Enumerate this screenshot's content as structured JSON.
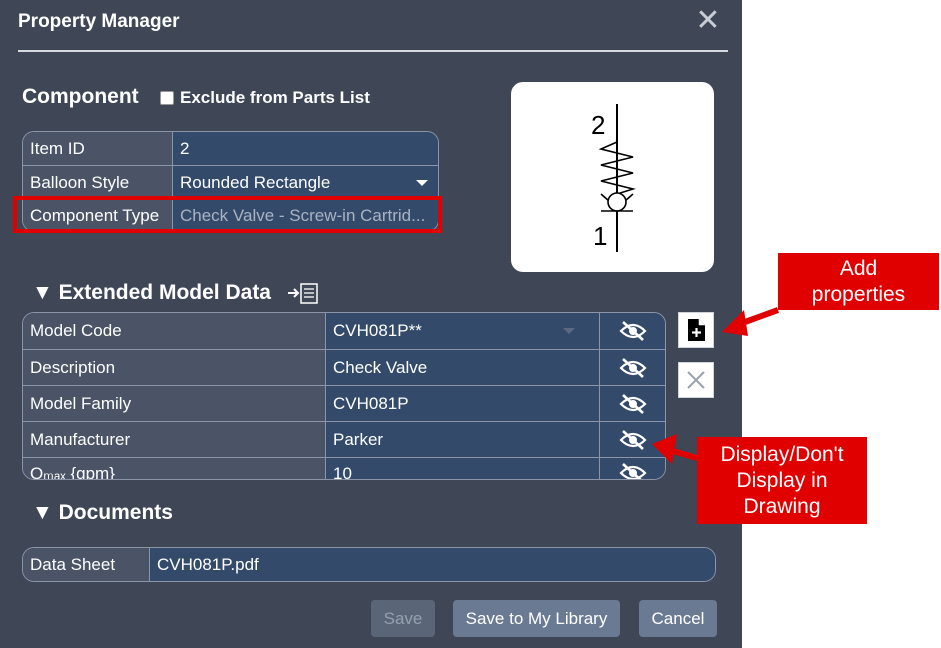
{
  "dialog": {
    "title": "Property Manager",
    "close_label": "✕"
  },
  "component": {
    "heading": "Component",
    "exclude_label": "Exclude from Parts List",
    "rows": [
      {
        "label": "Item ID",
        "value": "2"
      },
      {
        "label": "Balloon Style",
        "value": "Rounded Rectangle"
      },
      {
        "label": "Component Type",
        "value": "Check Valve - Screw-in Cartrid..."
      }
    ],
    "symbol_labels": {
      "top": "2",
      "bottom": "1"
    }
  },
  "extended": {
    "heading": "▼  Extended Model Data",
    "rows": [
      {
        "label": "Model Code",
        "value": "CVH081P**"
      },
      {
        "label": "Description",
        "value": "Check Valve"
      },
      {
        "label": "Model Family",
        "value": "CVH081P"
      },
      {
        "label": "Manufacturer",
        "value": "Parker"
      },
      {
        "label": "Qₘₐₓ {gpm}",
        "value": "10"
      }
    ]
  },
  "documents": {
    "heading": "▼  Documents",
    "rows": [
      {
        "label": "Data Sheet",
        "value": "CVH081P.pdf"
      }
    ]
  },
  "buttons": {
    "save": "Save",
    "save_library": "Save to My Library",
    "cancel": "Cancel"
  },
  "callouts": {
    "add": "Add properties",
    "display": "Display/Don't Display in Drawing"
  },
  "colors": {
    "panel_bg": "#3f4757",
    "value_bg": "#334a6b",
    "label_bg": "#4a5466",
    "highlight_red": "#e00000"
  }
}
